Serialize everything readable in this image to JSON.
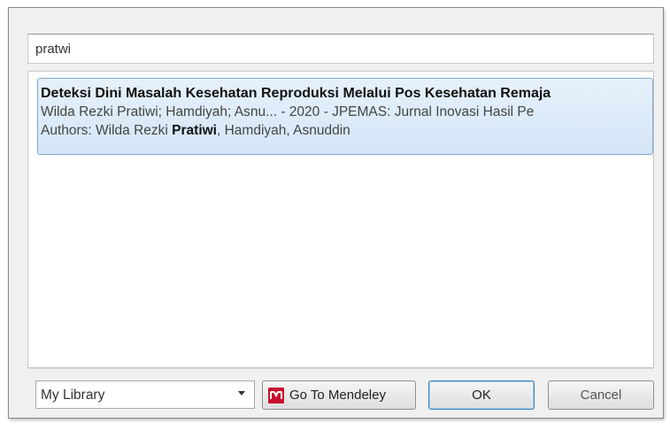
{
  "search": {
    "value": "pratwi"
  },
  "results": [
    {
      "title": "Deteksi Dini Masalah Kesehatan Reproduksi Melalui Pos Kesehatan Remaja",
      "citation": "Wilda Rezki Pratiwi; Hamdiyah; Asnu... - 2020 - JPEMAS: Jurnal Inovasi Hasil Pe",
      "authors_prefix": "Authors: Wilda Rezki ",
      "authors_match": "Pratiwi",
      "authors_suffix": ", Hamdiyah, Asnuddin"
    }
  ],
  "footer": {
    "library_select": "My Library",
    "mendeley_button": "Go To Mendeley",
    "ok_button": "OK",
    "cancel_button": "Cancel"
  },
  "colors": {
    "selection_bg": "#d5e6f7",
    "selection_border": "#7fa6d1",
    "mendeley_red": "#c8102e"
  },
  "icons": {
    "mendeley": "mendeley-logo-icon",
    "dropdown": "chevron-down-icon"
  }
}
